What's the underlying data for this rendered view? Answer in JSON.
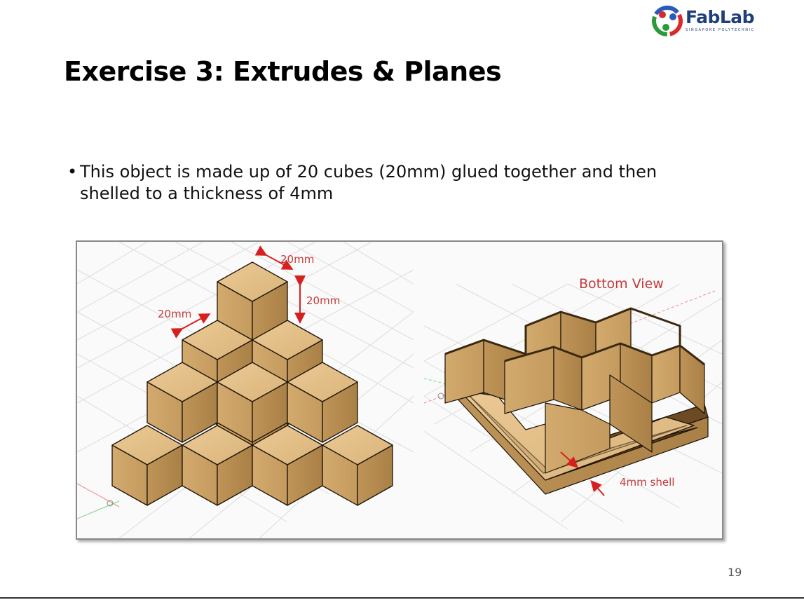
{
  "logo": {
    "name": "FabLab",
    "sub": "SINGAPORE POLYTECHNIC",
    "colors": [
      "#d62b2b",
      "#2a9a3a",
      "#2a5bb8"
    ]
  },
  "slide": {
    "title": "Exercise 3: Extrudes & Planes",
    "bullet": "This object is made up of 20 cubes (20mm) glued together and then shelled to a thickness of 4mm",
    "bullet_marker": "•",
    "page_number": "19"
  },
  "figure": {
    "left_labels": {
      "dim_top": "20mm",
      "dim_height": "20mm",
      "dim_left": "20mm"
    },
    "right_labels": {
      "view_title": "Bottom View",
      "shell_label": "4mm shell"
    },
    "colors": {
      "cube_top": "#e3bf88",
      "cube_left": "#cda469",
      "cube_right": "#b98e55",
      "edge": "#1b1208",
      "dimension": "#d62020",
      "grid": "#d9d9d9"
    }
  }
}
